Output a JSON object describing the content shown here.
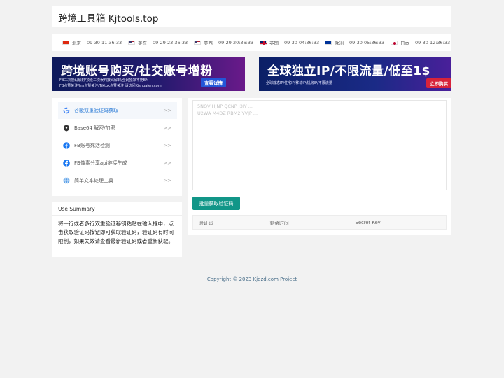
{
  "header": {
    "title": "跨境工具箱 Kjtools.top"
  },
  "clocks": [
    {
      "flag": "cn",
      "zone": "北京",
      "time": "09-30 11:36:33"
    },
    {
      "flag": "us",
      "zone": "美东",
      "time": "09-29 23:36:33"
    },
    {
      "flag": "us",
      "zone": "美西",
      "time": "09-29 20:36:33"
    },
    {
      "flag": "uk",
      "zone": "英国",
      "time": "09-30 04:36:33"
    },
    {
      "flag": "eu",
      "zone": "欧洲",
      "time": "09-30 05:36:33"
    },
    {
      "flag": "jp",
      "zone": "日本",
      "time": "09-30 12:36:33"
    }
  ],
  "banners": [
    {
      "headline": "跨境账号购买/社交账号增粉",
      "line1": "FB二次接码解封/顶级三次误判接码解封/全网独家不死BM",
      "line2": "FB点赞关注/Ins点赞关注/Tiktok点赞关注 请访问Kjshuafen.com",
      "cta": "查看详情"
    },
    {
      "headline": "全球独立IP/不限流量/低至1$",
      "line1": "全球静态IP/住宅IP/移动IP/机房IP/不限流量",
      "cta": "立即购买"
    }
  ],
  "tools": [
    {
      "label": "谷歌双重验证码获取",
      "icon": "google-icon",
      "arrow": ">>",
      "active": true
    },
    {
      "label": "Base64 解密/加密",
      "icon": "shield-icon",
      "arrow": ">>"
    },
    {
      "label": "FB账号死活检测",
      "icon": "facebook-icon",
      "arrow": ">>"
    },
    {
      "label": "FB像素分享api链接生成",
      "icon": "facebook-icon",
      "arrow": ">>"
    },
    {
      "label": "简单文本处理工具",
      "icon": "globe-icon",
      "arrow": ">>"
    }
  ],
  "summary": {
    "title": "Use Summary",
    "text": "将一行或者多行双重验证秘钥粘贴在输入框中，点击获取验证码按钮即可获取验证码，验证码有时间限制，如果失效请查看最新验证码或者重新获取。"
  },
  "main": {
    "placeholder": "5NQV HJNP QCNP J3IY ...\nU2WA M4DZ RBM2 YVJP ...",
    "button": "批量获取验证码",
    "columns": [
      "验证码",
      "剩余时间",
      "Secret Key"
    ]
  },
  "footer": {
    "text": "Copyright © 2023 Kjdzd.com Project"
  },
  "colors": {
    "accent": "#119688",
    "link": "#2b7bd6",
    "background": "#f2f2f2"
  }
}
